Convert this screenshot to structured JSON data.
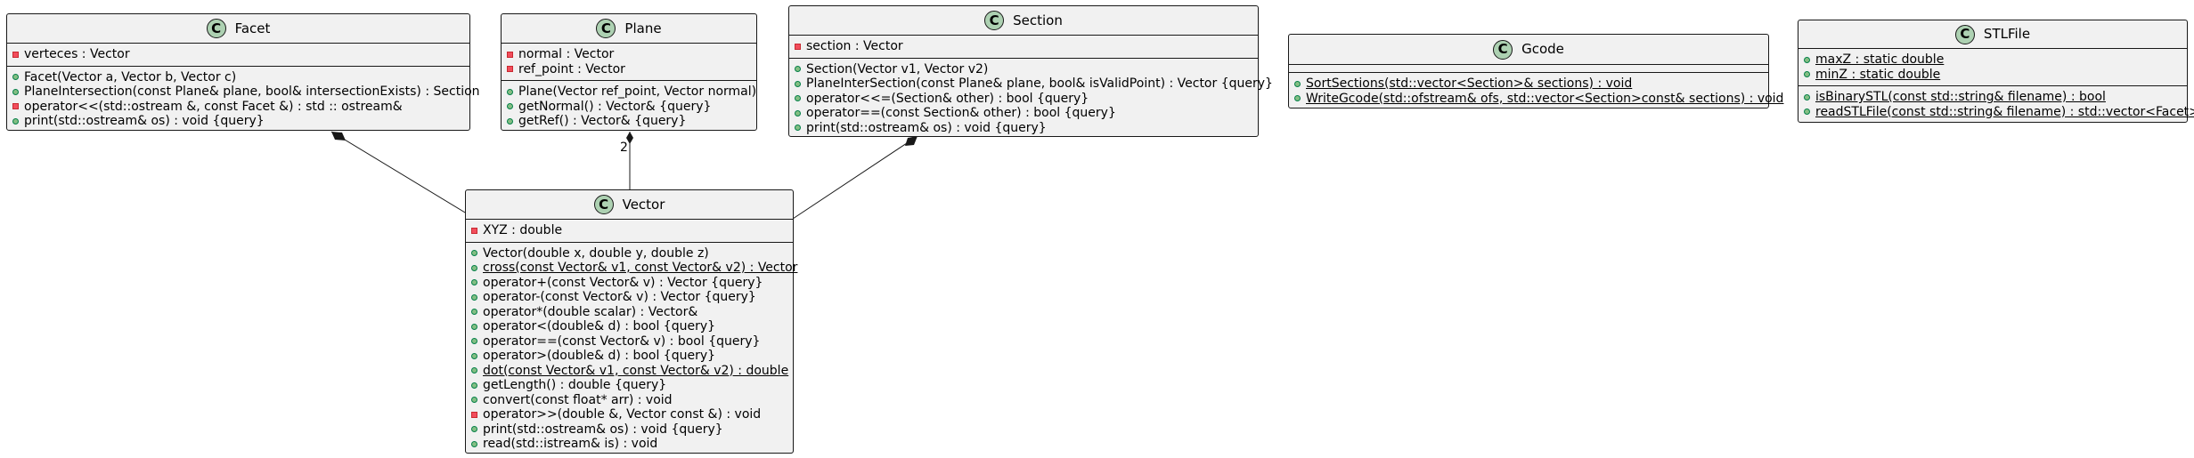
{
  "classes": {
    "facet": {
      "name": "Facet",
      "fields": [
        {
          "vis": "private",
          "text": "verteces : Vector"
        }
      ],
      "methods": [
        {
          "vis": "public",
          "text": "Facet(Vector a, Vector b, Vector c)"
        },
        {
          "vis": "public",
          "text": "PlaneIntersection(const Plane& plane, bool& intersectionExists) : Section"
        },
        {
          "vis": "private",
          "text": "operator<<(std::ostream &, const Facet &) : std :: ostream&"
        },
        {
          "vis": "public",
          "text": "print(std::ostream& os) : void {query}"
        }
      ]
    },
    "plane": {
      "name": "Plane",
      "fields": [
        {
          "vis": "private",
          "text": "normal : Vector"
        },
        {
          "vis": "private",
          "text": "ref_point : Vector"
        }
      ],
      "methods": [
        {
          "vis": "public",
          "text": "Plane(Vector ref_point, Vector normal)"
        },
        {
          "vis": "public",
          "text": "getNormal() : Vector& {query}"
        },
        {
          "vis": "public",
          "text": "getRef() : Vector& {query}"
        }
      ]
    },
    "section": {
      "name": "Section",
      "fields": [
        {
          "vis": "private",
          "text": "section : Vector"
        }
      ],
      "methods": [
        {
          "vis": "public",
          "text": "Section(Vector v1, Vector v2)"
        },
        {
          "vis": "public",
          "text": "PlaneInterSection(const Plane& plane, bool& isValidPoint) : Vector {query}"
        },
        {
          "vis": "public",
          "text": "operator<<=(Section& other) : bool {query}"
        },
        {
          "vis": "public",
          "text": "operator==(const Section& other) : bool {query}"
        },
        {
          "vis": "public",
          "text": "print(std::ostream& os) : void {query}"
        }
      ]
    },
    "gcode": {
      "name": "Gcode",
      "fields": [],
      "methods": [
        {
          "vis": "public",
          "static": true,
          "text": "SortSections(std::vector<Section>& sections) : void"
        },
        {
          "vis": "public",
          "static": true,
          "text": "WriteGcode(std::ofstream& ofs, std::vector<Section>const& sections) : void"
        }
      ]
    },
    "stlfile": {
      "name": "STLFile",
      "fields": [
        {
          "vis": "public",
          "static": true,
          "text": "maxZ : static double"
        },
        {
          "vis": "public",
          "static": true,
          "text": "minZ : static double"
        }
      ],
      "methods": [
        {
          "vis": "public",
          "static": true,
          "text": "isBinarySTL(const std::string& filename) : bool"
        },
        {
          "vis": "public",
          "static": true,
          "text": "readSTLFile(const std::string& filename) : std::vector<Facet>"
        }
      ]
    },
    "vector": {
      "name": "Vector",
      "fields": [
        {
          "vis": "private",
          "text": "XYZ : double"
        }
      ],
      "methods": [
        {
          "vis": "public",
          "text": "Vector(double x, double y, double z)"
        },
        {
          "vis": "public",
          "static": true,
          "text": "cross(const Vector& v1, const Vector& v2) : Vector"
        },
        {
          "vis": "public",
          "text": "operator+(const Vector& v) : Vector {query}"
        },
        {
          "vis": "public",
          "text": "operator-(const Vector& v) : Vector {query}"
        },
        {
          "vis": "public",
          "text": "operator*(double scalar) : Vector&"
        },
        {
          "vis": "public",
          "text": "operator<(double& d) : bool {query}"
        },
        {
          "vis": "public",
          "text": "operator==(const Vector& v) : bool {query}"
        },
        {
          "vis": "public",
          "text": "operator>(double& d) : bool {query}"
        },
        {
          "vis": "public",
          "static": true,
          "text": "dot(const Vector& v1, const Vector& v2) : double"
        },
        {
          "vis": "public",
          "text": "getLength() : double {query}"
        },
        {
          "vis": "public",
          "text": "convert(const float* arr) : void"
        },
        {
          "vis": "private",
          "text": "operator>>(double &, Vector const &) : void"
        },
        {
          "vis": "public",
          "text": "print(std::ostream& os) : void {query}"
        },
        {
          "vis": "public",
          "text": "read(std::istream& is) : void"
        }
      ]
    }
  },
  "class_icon": "C",
  "relations": [
    {
      "from": "Facet",
      "to": "Vector",
      "type": "composition",
      "multiplicity": ""
    },
    {
      "from": "Plane",
      "to": "Vector",
      "type": "composition",
      "multiplicity": "2"
    },
    {
      "from": "Section",
      "to": "Vector",
      "type": "composition",
      "multiplicity": ""
    }
  ]
}
